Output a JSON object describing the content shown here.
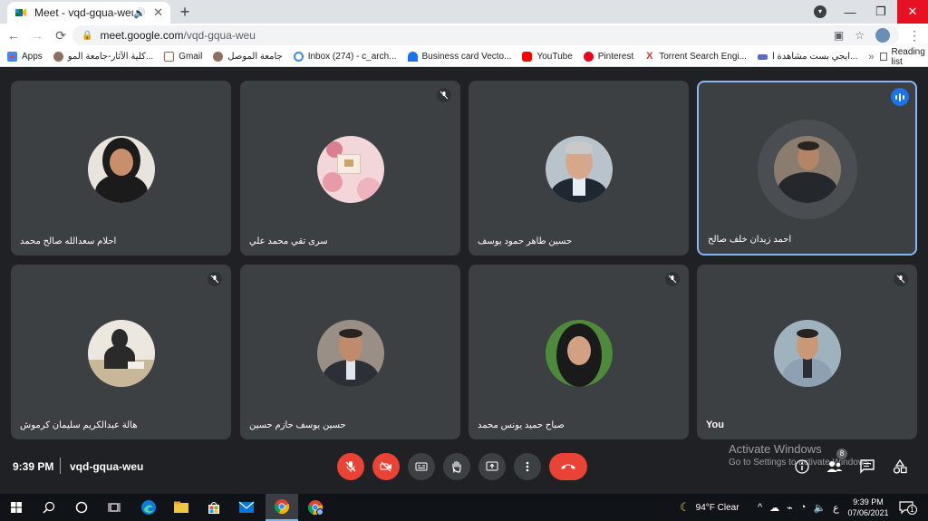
{
  "browser": {
    "tab_title": "Meet - vqd-gqua-weu",
    "new_tab": "+",
    "url_host": "meet.google.com",
    "url_path": "/vqd-gqua-weu"
  },
  "bookmarks": {
    "items": [
      {
        "label": "Apps",
        "color": "#4285f4"
      },
      {
        "label": "كلية الآثار-جامعة المو...",
        "color": "#8d6e63"
      },
      {
        "label": "Gmail",
        "color": "#ea4335"
      },
      {
        "label": "جامعة الموصل",
        "color": "#8d6e63"
      },
      {
        "label": "Inbox (274) - c_arch...",
        "color": "#4285f4"
      },
      {
        "label": "Business card Vecto...",
        "color": "#1a73e8"
      },
      {
        "label": "YouTube",
        "color": "#ff0000"
      },
      {
        "label": "Pinterest",
        "color": "#e60023"
      },
      {
        "label": "Torrent Search Engi...",
        "color": "#d93025"
      },
      {
        "label": "ايجي بست مشاهدة ا...",
        "color": "#5c6bc0"
      }
    ],
    "more": "»",
    "reading_list": "Reading list"
  },
  "participants": [
    {
      "name": "احلام سعدالله صالح محمد",
      "muted": false,
      "speaking": false
    },
    {
      "name": "سرى تقي محمد علي",
      "muted": true,
      "speaking": false
    },
    {
      "name": "حسين طاهر حمود يوسف",
      "muted": false,
      "speaking": false
    },
    {
      "name": "احمد زيدان خلف صالح",
      "muted": false,
      "speaking": true
    },
    {
      "name": "هالة عبدالكريم سليمان كرموش",
      "muted": true,
      "speaking": false
    },
    {
      "name": "حسين يوسف حازم حسين",
      "muted": false,
      "speaking": false
    },
    {
      "name": "صباح حميد يونس محمد",
      "muted": true,
      "speaking": false
    },
    {
      "name": "You",
      "muted": true,
      "speaking": false
    }
  ],
  "meeting": {
    "time": "9:39 PM",
    "separator": "|",
    "code": "vqd-gqua-weu",
    "people_count": "8",
    "activate_title": "Activate Windows",
    "activate_sub": "Go to Settings to activate Windows."
  },
  "taskbar": {
    "weather": "94°F  Clear",
    "lang": "ع",
    "time": "9:39 PM",
    "date": "07/06/2021",
    "notifications": "1"
  },
  "colors": {
    "accent": "#8ab4f8",
    "danger": "#ea4335",
    "tile": "#3c4043",
    "stage": "#202124"
  }
}
